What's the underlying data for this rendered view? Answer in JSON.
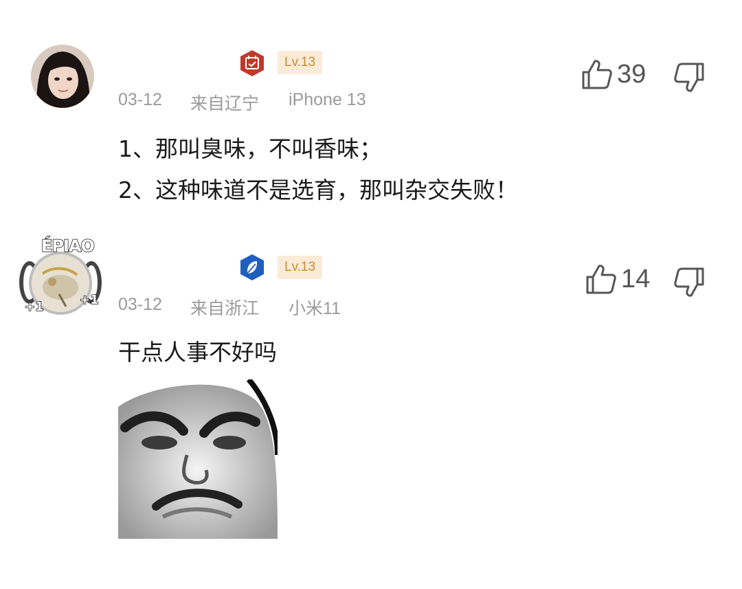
{
  "comments": [
    {
      "level": "Lv.13",
      "date": "03-12",
      "location": "来自辽宁",
      "device": "iPhone 13",
      "likes": "39",
      "lines": [
        "1、那叫臭味，不叫香味；",
        "2、这种味道不是选育，那叫杂交失败！"
      ],
      "badge_icon": "calendar-check-icon",
      "badge_color": "#c0392b"
    },
    {
      "level": "Lv.13",
      "date": "03-12",
      "location": "来自浙江",
      "device": "小米11",
      "likes": "14",
      "lines": [
        "干点人事不好吗"
      ],
      "badge_icon": "feather-icon",
      "badge_color": "#1f5fbf",
      "frame_label": "ÉPIAO",
      "frame_plus": "+1",
      "has_meme_image": true
    }
  ]
}
